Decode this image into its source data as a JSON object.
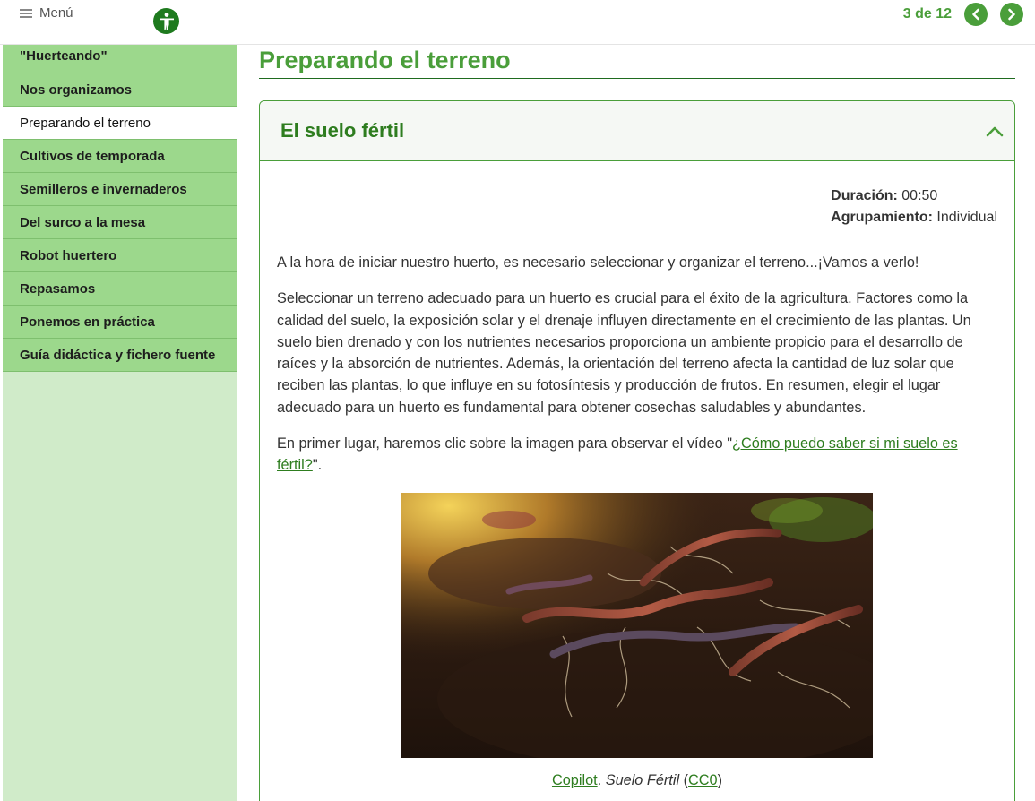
{
  "topbar": {
    "menu_label": "Menú",
    "accessibility_icon": "accessibility-icon",
    "pager_text": "3 de 12",
    "prev_icon": "chevron-left-icon",
    "next_icon": "chevron-right-icon"
  },
  "sidebar": {
    "items": [
      {
        "label": "\"Huerteando\""
      },
      {
        "label": "Nos organizamos"
      },
      {
        "label": "Preparando el terreno"
      },
      {
        "label": "Cultivos de temporada"
      },
      {
        "label": "Semilleros e invernaderos"
      },
      {
        "label": "Del surco a la mesa"
      },
      {
        "label": "Robot huertero"
      },
      {
        "label": "Repasamos"
      },
      {
        "label": "Ponemos en práctica"
      },
      {
        "label": "Guía didáctica y fichero fuente"
      }
    ],
    "active_index": 2
  },
  "main": {
    "page_title": "Preparando el terreno",
    "card": {
      "title": "El suelo fértil",
      "collapse_icon": "chevron-up-icon",
      "meta": {
        "duration_label": "Duración:",
        "duration_value": "00:50",
        "grouping_label": "Agrupamiento:",
        "grouping_value": "Individual"
      },
      "paragraphs": [
        "A la hora de iniciar nuestro huerto, es necesario seleccionar y organizar el terreno...¡Vamos a verlo!",
        "Seleccionar un terreno adecuado para un huerto es crucial para el éxito de la agricultura. Factores como la calidad del suelo, la exposición solar y el drenaje influyen directamente en el crecimiento de las plantas. Un suelo bien drenado y con los nutrientes necesarios proporciona un ambiente propicio para el desarrollo de raíces y la absorción de nutrientes. Además, la orientación del terreno afecta la cantidad de luz solar que reciben las plantas, lo que influye en su fotosíntesis y producción de frutos. En resumen, elegir el lugar adecuado para un huerto es fundamental para obtener cosechas saludables y abundantes."
      ],
      "video_intro_before": "En primer lugar, haremos clic sobre la imagen para observar el vídeo \"",
      "video_link": "¿Cómo puedo saber si mi suelo es fértil?",
      "video_intro_after": "\".",
      "caption": {
        "author_link": "Copilot",
        "separator": ". ",
        "work_title": "Suelo Fértil",
        "license_open": " (",
        "license_link": "CC0",
        "license_close": ")"
      }
    }
  },
  "colors": {
    "accent": "#4a9e3a",
    "sidebar_item": "#9cd88c",
    "sidebar_bg": "#d0ebc9",
    "title_green": "#2e7d1f"
  }
}
